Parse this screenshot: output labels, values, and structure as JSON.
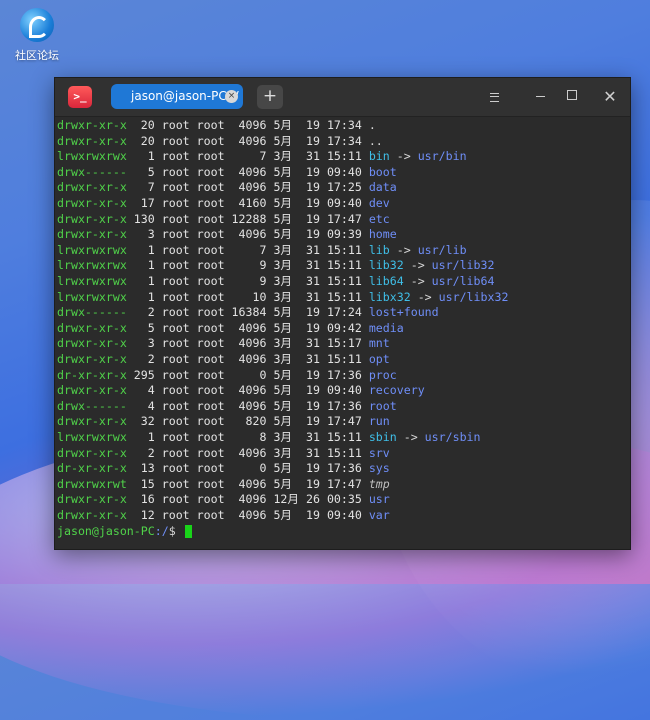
{
  "desktop": {
    "icon_label": "社区论坛"
  },
  "window": {
    "tab_title": "jason@jason-PC: /",
    "tab_close": "×",
    "new_tab": "+",
    "menu_icon": "menu-icon",
    "min_icon": "minimize-icon",
    "max_icon": "maximize-icon",
    "close_icon": "close-icon",
    "app_icon_text": ">_"
  },
  "listing": [
    {
      "perm": "drwxr-xr-x",
      "links": "20",
      "user": "root",
      "group": "root",
      "size": "4096",
      "month": "5月",
      "day": "19",
      "time": "17:34",
      "name": ".",
      "kind": "plain"
    },
    {
      "perm": "drwxr-xr-x",
      "links": "20",
      "user": "root",
      "group": "root",
      "size": "4096",
      "month": "5月",
      "day": "19",
      "time": "17:34",
      "name": "..",
      "kind": "plain"
    },
    {
      "perm": "lrwxrwxrwx",
      "links": "1",
      "user": "root",
      "group": "root",
      "size": "7",
      "month": "3月",
      "day": "31",
      "time": "15:11",
      "name": "bin",
      "kind": "link",
      "target": "usr/bin"
    },
    {
      "perm": "drwx------",
      "links": "5",
      "user": "root",
      "group": "root",
      "size": "4096",
      "month": "5月",
      "day": "19",
      "time": "09:40",
      "name": "boot",
      "kind": "dir"
    },
    {
      "perm": "drwxr-xr-x",
      "links": "7",
      "user": "root",
      "group": "root",
      "size": "4096",
      "month": "5月",
      "day": "19",
      "time": "17:25",
      "name": "data",
      "kind": "dir"
    },
    {
      "perm": "drwxr-xr-x",
      "links": "17",
      "user": "root",
      "group": "root",
      "size": "4160",
      "month": "5月",
      "day": "19",
      "time": "09:40",
      "name": "dev",
      "kind": "dir"
    },
    {
      "perm": "drwxr-xr-x",
      "links": "130",
      "user": "root",
      "group": "root",
      "size": "12288",
      "month": "5月",
      "day": "19",
      "time": "17:47",
      "name": "etc",
      "kind": "dir"
    },
    {
      "perm": "drwxr-xr-x",
      "links": "3",
      "user": "root",
      "group": "root",
      "size": "4096",
      "month": "5月",
      "day": "19",
      "time": "09:39",
      "name": "home",
      "kind": "dir"
    },
    {
      "perm": "lrwxrwxrwx",
      "links": "1",
      "user": "root",
      "group": "root",
      "size": "7",
      "month": "3月",
      "day": "31",
      "time": "15:11",
      "name": "lib",
      "kind": "link",
      "target": "usr/lib"
    },
    {
      "perm": "lrwxrwxrwx",
      "links": "1",
      "user": "root",
      "group": "root",
      "size": "9",
      "month": "3月",
      "day": "31",
      "time": "15:11",
      "name": "lib32",
      "kind": "link",
      "target": "usr/lib32"
    },
    {
      "perm": "lrwxrwxrwx",
      "links": "1",
      "user": "root",
      "group": "root",
      "size": "9",
      "month": "3月",
      "day": "31",
      "time": "15:11",
      "name": "lib64",
      "kind": "link",
      "target": "usr/lib64"
    },
    {
      "perm": "lrwxrwxrwx",
      "links": "1",
      "user": "root",
      "group": "root",
      "size": "10",
      "month": "3月",
      "day": "31",
      "time": "15:11",
      "name": "libx32",
      "kind": "link",
      "target": "usr/libx32"
    },
    {
      "perm": "drwx------",
      "links": "2",
      "user": "root",
      "group": "root",
      "size": "16384",
      "month": "5月",
      "day": "19",
      "time": "17:24",
      "name": "lost+found",
      "kind": "dir"
    },
    {
      "perm": "drwxr-xr-x",
      "links": "5",
      "user": "root",
      "group": "root",
      "size": "4096",
      "month": "5月",
      "day": "19",
      "time": "09:42",
      "name": "media",
      "kind": "dir"
    },
    {
      "perm": "drwxr-xr-x",
      "links": "3",
      "user": "root",
      "group": "root",
      "size": "4096",
      "month": "3月",
      "day": "31",
      "time": "15:17",
      "name": "mnt",
      "kind": "dir"
    },
    {
      "perm": "drwxr-xr-x",
      "links": "2",
      "user": "root",
      "group": "root",
      "size": "4096",
      "month": "3月",
      "day": "31",
      "time": "15:11",
      "name": "opt",
      "kind": "dir"
    },
    {
      "perm": "dr-xr-xr-x",
      "links": "295",
      "user": "root",
      "group": "root",
      "size": "0",
      "month": "5月",
      "day": "19",
      "time": "17:36",
      "name": "proc",
      "kind": "dir"
    },
    {
      "perm": "drwxr-xr-x",
      "links": "4",
      "user": "root",
      "group": "root",
      "size": "4096",
      "month": "5月",
      "day": "19",
      "time": "09:40",
      "name": "recovery",
      "kind": "dir"
    },
    {
      "perm": "drwx------",
      "links": "4",
      "user": "root",
      "group": "root",
      "size": "4096",
      "month": "5月",
      "day": "19",
      "time": "17:36",
      "name": "root",
      "kind": "dir"
    },
    {
      "perm": "drwxr-xr-x",
      "links": "32",
      "user": "root",
      "group": "root",
      "size": "820",
      "month": "5月",
      "day": "19",
      "time": "17:47",
      "name": "run",
      "kind": "dir"
    },
    {
      "perm": "lrwxrwxrwx",
      "links": "1",
      "user": "root",
      "group": "root",
      "size": "8",
      "month": "3月",
      "day": "31",
      "time": "15:11",
      "name": "sbin",
      "kind": "link",
      "target": "usr/sbin"
    },
    {
      "perm": "drwxr-xr-x",
      "links": "2",
      "user": "root",
      "group": "root",
      "size": "4096",
      "month": "3月",
      "day": "31",
      "time": "15:11",
      "name": "srv",
      "kind": "dir"
    },
    {
      "perm": "dr-xr-xr-x",
      "links": "13",
      "user": "root",
      "group": "root",
      "size": "0",
      "month": "5月",
      "day": "19",
      "time": "17:36",
      "name": "sys",
      "kind": "dir"
    },
    {
      "perm": "drwxrwxrwt",
      "links": "15",
      "user": "root",
      "group": "root",
      "size": "4096",
      "month": "5月",
      "day": "19",
      "time": "17:47",
      "name": "tmp",
      "kind": "sticky"
    },
    {
      "perm": "drwxr-xr-x",
      "links": "16",
      "user": "root",
      "group": "root",
      "size": "4096",
      "month": "12月",
      "day": "26",
      "time": "00:35",
      "name": "usr",
      "kind": "dir"
    },
    {
      "perm": "drwxr-xr-x",
      "links": "12",
      "user": "root",
      "group": "root",
      "size": "4096",
      "month": "5月",
      "day": "19",
      "time": "09:40",
      "name": "var",
      "kind": "dir"
    }
  ],
  "prompt": {
    "user_host": "jason@jason-PC",
    "path": ":/",
    "symbol": "$ "
  }
}
